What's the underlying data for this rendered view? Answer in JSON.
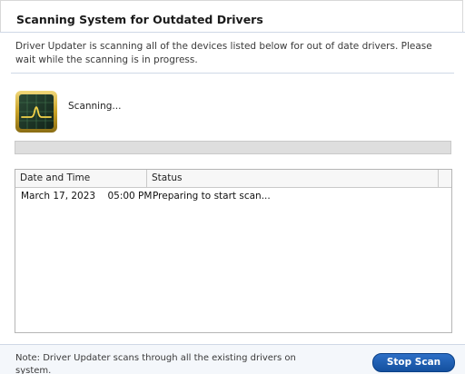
{
  "dialog": {
    "title": "Scanning System for Outdated Drivers",
    "description": "Driver Updater is scanning all of the devices listed below for out of date drivers. Please wait while the scanning is in progress."
  },
  "scan": {
    "status_label": "Scanning...",
    "progress_percent": 0,
    "icon": "monitor-waveform-icon"
  },
  "log_table": {
    "columns": [
      "Date and Time",
      "Status"
    ],
    "rows": [
      {
        "date_time": "March 17, 2023    05:00 PM",
        "status": "Preparing to start scan..."
      }
    ]
  },
  "footer": {
    "note": "Note: Driver Updater scans through all the existing drivers on system.",
    "stop_button_label": "Stop Scan"
  },
  "colors": {
    "button_blue": "#14509f",
    "icon_frame_gold": "#c9a227",
    "icon_screen": "#1e3a2a",
    "progress_track": "#dedede"
  }
}
